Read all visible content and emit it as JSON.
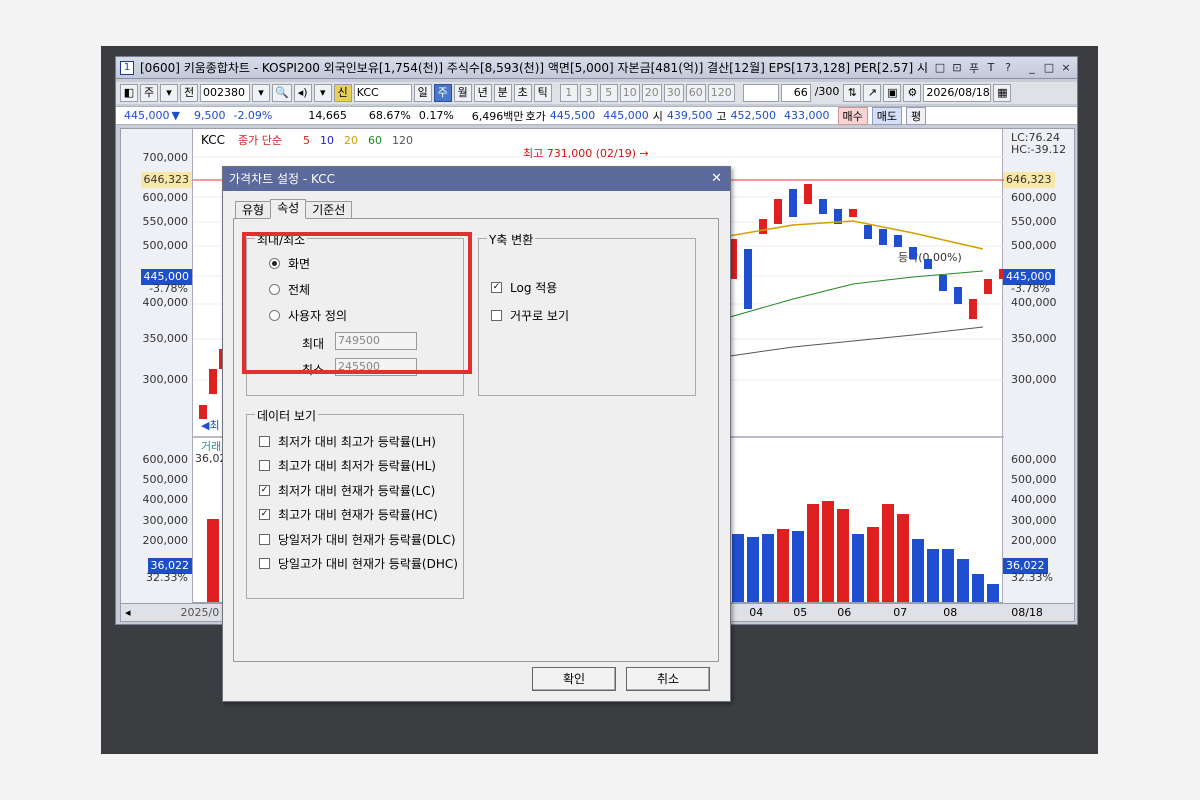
{
  "window": {
    "number": "1",
    "title": "[0600] 키움종합차트 - KOSPI200 외국인보유[1,754(천)] 주식수[8,593(천)] 액면[5,000] 자본금[481(억)] 결산[12월] EPS[173,128] PER[2.57] 시",
    "controls": [
      "□",
      "⊡",
      "푸",
      "T",
      "?",
      "_",
      "□",
      "×"
    ]
  },
  "toolbar": {
    "period_select": "주",
    "scope": "전",
    "code": "002380",
    "sin": "신",
    "stock_name": "KCC",
    "periods": [
      "일",
      "주",
      "월",
      "년",
      "분",
      "초",
      "틱"
    ],
    "active_period": "주",
    "intervals": [
      "1",
      "3",
      "5",
      "10",
      "20",
      "30",
      "60",
      "120"
    ],
    "count": "66",
    "count_total": "/300",
    "date": "2026/08/18"
  },
  "quote": {
    "price": "445,000",
    "change": "9,500",
    "change_pct": "-2.09%",
    "volume": "14,665",
    "vol_ratio": "68.67%",
    "turnover": "0.17%",
    "amount": "6,496백만",
    "ask_label": "호가",
    "ask1": "445,500",
    "ask2": "445,000",
    "open_label": "시",
    "open": "439,500",
    "high_label": "고",
    "high": "452,500",
    "low": "433,000",
    "buy": "매수",
    "sell": "매도",
    "avg": "평"
  },
  "chart": {
    "symbol": "KCC",
    "ma_label": "종가 단순",
    "ma_periods": [
      "5",
      "10",
      "20",
      "60",
      "120"
    ],
    "ma_colors": [
      "#cc2222",
      "#2222cc",
      "#d4a000",
      "#228822",
      "#555555"
    ],
    "lc": "LC:76.24",
    "hc": "HC:-39.12",
    "price_ticks": [
      "700,000",
      "600,000",
      "550,000",
      "500,000",
      "450,000",
      "400,000",
      "350,000",
      "300,000"
    ],
    "current_line": "646,323",
    "current_price": "445,000",
    "current_pct": "-3.78%",
    "high_note": "최고 731,000 (02/19) →",
    "low_note": "◀최",
    "eq_note": "등락(0.00%)",
    "volume_label": "거래",
    "volume_value": "36,022",
    "volume_ticks": [
      "600,000",
      "500,000",
      "400,000",
      "300,000",
      "200,000",
      "100,000"
    ],
    "volume_tag": "36,022",
    "volume_pct": "32.33%",
    "x_labels": [
      "2025/0",
      "04",
      "05",
      "06",
      "07",
      "08",
      "08/18"
    ]
  },
  "dialog": {
    "title": "가격차트 설정 - KCC",
    "tabs": [
      "유형",
      "속성",
      "기준선"
    ],
    "active_tab": "속성",
    "minmax_group": "최대/최소",
    "radio_screen": "화면",
    "radio_all": "전체",
    "radio_custom": "사용자 정의",
    "max_label": "최대",
    "max_value": "749500",
    "min_label": "최소",
    "min_value": "245500",
    "y_group": "Y축 변환",
    "log_label": "Log 적용",
    "log_checked": true,
    "reverse_label": "거꾸로 보기",
    "data_group": "데이터 보기",
    "data_items": [
      {
        "label": "최저가 대비 최고가 등락률(LH)",
        "checked": false
      },
      {
        "label": "최고가 대비 최저가 등락률(HL)",
        "checked": false
      },
      {
        "label": "최저가 대비 현재가 등락률(LC)",
        "checked": true
      },
      {
        "label": "최고가 대비 현재가 등락률(HC)",
        "checked": true
      },
      {
        "label": "당일저가 대비 현재가 등락률(DLC)",
        "checked": false
      },
      {
        "label": "당일고가 대비 현재가 등락률(DHC)",
        "checked": false
      }
    ],
    "ok": "확인",
    "cancel": "취소"
  }
}
